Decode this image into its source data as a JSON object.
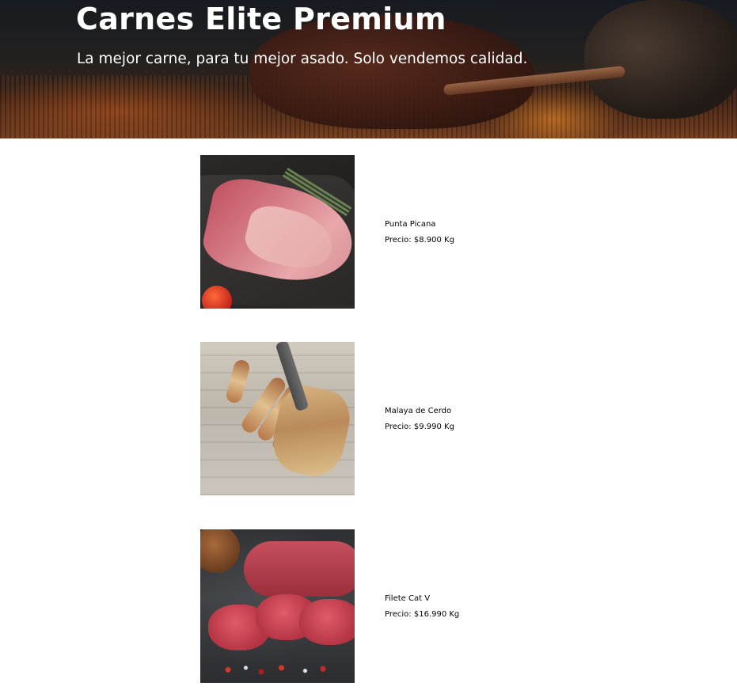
{
  "header": {
    "title": "Carnes Elite Premium",
    "subtitle": "La mejor carne, para tu mejor asado. Solo vendemos calidad."
  },
  "products": [
    {
      "name": "Punta Picana",
      "price": "Precio: $8.900 Kg",
      "image_icon": "punta-picana-photo"
    },
    {
      "name": "Malaya de Cerdo",
      "price": "Precio: $9.990 Kg",
      "image_icon": "malaya-de-cerdo-photo"
    },
    {
      "name": "Filete Cat V",
      "price": "Precio: $16.990 Kg",
      "image_icon": "filete-photo"
    }
  ]
}
